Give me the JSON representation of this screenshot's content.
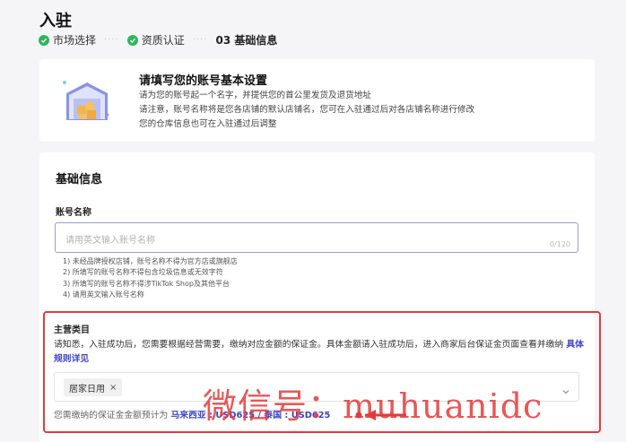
{
  "page": {
    "title": "入驻"
  },
  "steps": [
    {
      "label": "市场选择",
      "status": "done"
    },
    {
      "label": "资质认证",
      "status": "done"
    },
    {
      "label": "03 基础信息",
      "status": "current"
    }
  ],
  "intro": {
    "title": "请填写您的账号基本设置",
    "lines": [
      "请为您的账号起一个名字，并提供您的首公里发货及退货地址",
      "请注意，账号名称将是您各店铺的默认店铺名，您可在入驻通过后对各店铺名称进行修改",
      "您的仓库信息也可在入驻通过后调整"
    ]
  },
  "basic_info": {
    "section_title": "基础信息",
    "account_name": {
      "label": "账号名称",
      "placeholder": "请用英文输入账号名称",
      "counter": "0/120",
      "rules": [
        "1) 未经品牌授权店铺，账号名称不得为官方店或旗舰店",
        "2) 所填写的账号名称不得包含垃圾信息或无效字符",
        "3) 所填写的账号名称不得涉TikTok Shop及其他平台",
        "4) 请用英文输入账号名称"
      ]
    },
    "main_category": {
      "label": "主营类目",
      "notice": "请知悉，入驻成功后，您需要根据经营需要，缴纳对应金额的保证金。具体金额请入驻成功后，进入商家后台保证金页面查看并缴纳",
      "notice_link": "具体规则详见",
      "selected_tag": "居家日用",
      "deposit_prefix": "您需缴纳的保证金金额预计为",
      "deposit_amounts": "马来西亚 : USD625 / 泰国 : USD625"
    }
  },
  "watermark": "微信号：muhuanidc",
  "colors": {
    "accent": "#3d44c9",
    "success": "#2fb55b",
    "highlight": "#e63a3a"
  }
}
